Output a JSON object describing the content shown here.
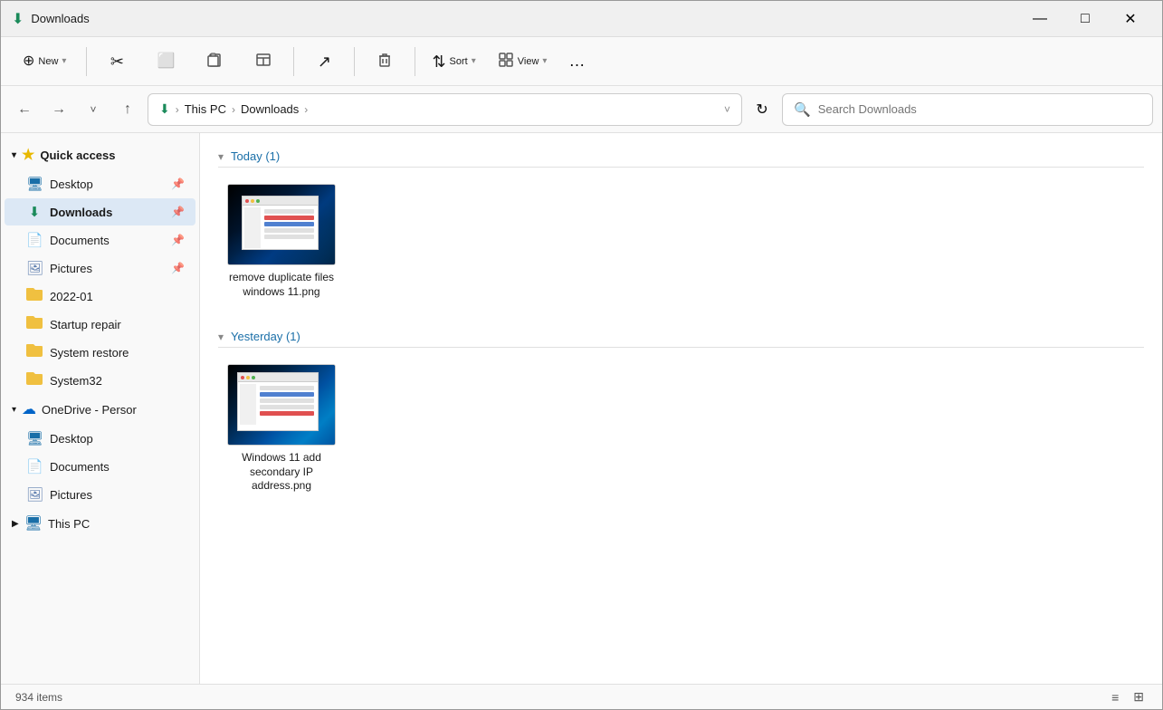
{
  "titleBar": {
    "title": "Downloads",
    "icon": "⬇",
    "minimize": "—",
    "maximize": "□",
    "close": "✕"
  },
  "toolbar": {
    "newLabel": "New",
    "newIcon": "⊕",
    "cutIcon": "✂",
    "copyIcon": "⬜",
    "pasteIcon": "📋",
    "renameIcon": "📋",
    "shareIcon": "↗",
    "deleteIcon": "🗑",
    "sortLabel": "Sort",
    "sortIcon": "⇅",
    "viewLabel": "View",
    "viewIcon": "⬜",
    "moreIcon": "…"
  },
  "addressBar": {
    "backIcon": "←",
    "forwardIcon": "→",
    "recentIcon": "˅",
    "upIcon": "↑",
    "refreshIcon": "↻",
    "downloadIcon": "⬇",
    "thisPCLabel": "This PC",
    "downloadsLabel": "Downloads",
    "chevron": "›",
    "searchPlaceholder": "Search Downloads"
  },
  "sidebar": {
    "quickAccessLabel": "Quick access",
    "items": [
      {
        "id": "desktop-pinned",
        "label": "Desktop",
        "icon": "🖥",
        "pinned": true
      },
      {
        "id": "downloads-pinned",
        "label": "Downloads",
        "icon": "⬇",
        "pinned": true,
        "active": true
      },
      {
        "id": "documents-pinned",
        "label": "Documents",
        "icon": "📄",
        "pinned": true
      },
      {
        "id": "pictures-pinned",
        "label": "Pictures",
        "icon": "🖼",
        "pinned": true
      },
      {
        "id": "folder-2022",
        "label": "2022-01",
        "icon": "folder",
        "pinned": false
      },
      {
        "id": "folder-startup",
        "label": "Startup repair",
        "icon": "folder",
        "pinned": false
      },
      {
        "id": "folder-sysrestore",
        "label": "System restore",
        "icon": "folder",
        "pinned": false
      },
      {
        "id": "folder-sys32",
        "label": "System32",
        "icon": "folder",
        "pinned": false
      }
    ],
    "oneDriveLabel": "OneDrive - Persor",
    "oneDriveIcon": "☁",
    "oneDriveItems": [
      {
        "id": "od-desktop",
        "label": "Desktop",
        "icon": "🖥"
      },
      {
        "id": "od-documents",
        "label": "Documents",
        "icon": "📄"
      },
      {
        "id": "od-pictures",
        "label": "Pictures",
        "icon": "🖼"
      }
    ],
    "thisPCLabel": "This PC",
    "thisPCIcon": "🖥"
  },
  "content": {
    "groups": [
      {
        "id": "today",
        "title": "Today (1)",
        "files": [
          {
            "id": "file1",
            "name": "remove duplicate files windows 11.png",
            "type": "image"
          }
        ]
      },
      {
        "id": "yesterday",
        "title": "Yesterday (1)",
        "files": [
          {
            "id": "file2",
            "name": "Windows 11 add secondary IP address.png",
            "type": "image"
          }
        ]
      }
    ]
  },
  "statusBar": {
    "itemCount": "934 items",
    "listViewIcon": "≡",
    "gridViewIcon": "⊞"
  }
}
